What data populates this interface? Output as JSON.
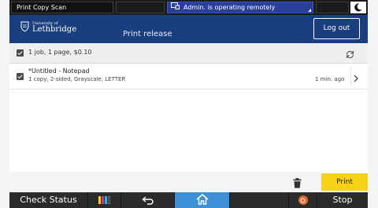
{
  "status_bar": {
    "app_tabs": "Print Copy Scan",
    "remote_notice": "Admin. is operating remotely"
  },
  "header": {
    "logo_line1": "University of",
    "logo_line2": "Lethbridge",
    "title": "Print release",
    "logout_label": "Log out"
  },
  "summary": {
    "text": "1 job, 1 page, $0.10"
  },
  "jobs": [
    {
      "title": "*Untitled - Notepad",
      "details": "1 copy, 2-sided, Grayscale, LETTER",
      "time": "1 min. ago"
    }
  ],
  "footer": {
    "print_label": "Print"
  },
  "device_bar": {
    "check_status_label": "Check Status",
    "stop_label": "Stop"
  },
  "colors": {
    "header_bg": "#1b3e7e",
    "print_button": "#f7d117",
    "home_button": "#3d8fd6",
    "remote_notice_bg": "#2a3f9c"
  },
  "icons": [
    "moon-icon",
    "university-logo-icon",
    "refresh-icon",
    "chevron-right-icon",
    "trash-icon",
    "toner-levels-icon",
    "back-icon",
    "home-icon",
    "stop-icon",
    "remote-icon"
  ]
}
